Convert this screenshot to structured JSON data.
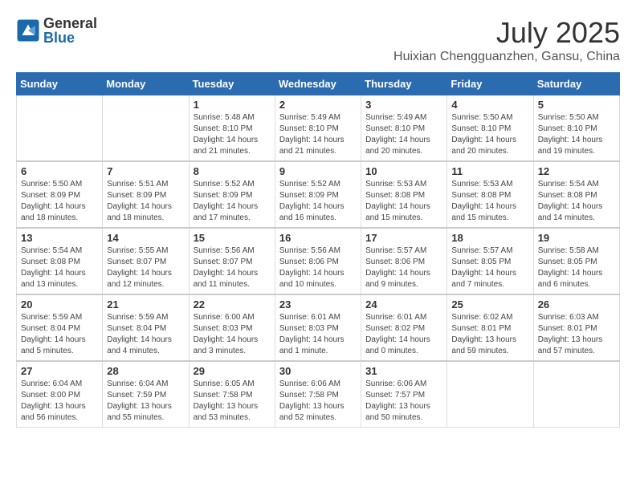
{
  "header": {
    "logo": {
      "general": "General",
      "blue": "Blue"
    },
    "title": "July 2025",
    "location": "Huixian Chengguanzhen, Gansu, China"
  },
  "calendar": {
    "days_of_week": [
      "Sunday",
      "Monday",
      "Tuesday",
      "Wednesday",
      "Thursday",
      "Friday",
      "Saturday"
    ],
    "weeks": [
      [
        {
          "day": "",
          "info": ""
        },
        {
          "day": "",
          "info": ""
        },
        {
          "day": "1",
          "info": "Sunrise: 5:48 AM\nSunset: 8:10 PM\nDaylight: 14 hours and 21 minutes."
        },
        {
          "day": "2",
          "info": "Sunrise: 5:49 AM\nSunset: 8:10 PM\nDaylight: 14 hours and 21 minutes."
        },
        {
          "day": "3",
          "info": "Sunrise: 5:49 AM\nSunset: 8:10 PM\nDaylight: 14 hours and 20 minutes."
        },
        {
          "day": "4",
          "info": "Sunrise: 5:50 AM\nSunset: 8:10 PM\nDaylight: 14 hours and 20 minutes."
        },
        {
          "day": "5",
          "info": "Sunrise: 5:50 AM\nSunset: 8:10 PM\nDaylight: 14 hours and 19 minutes."
        }
      ],
      [
        {
          "day": "6",
          "info": "Sunrise: 5:50 AM\nSunset: 8:09 PM\nDaylight: 14 hours and 18 minutes."
        },
        {
          "day": "7",
          "info": "Sunrise: 5:51 AM\nSunset: 8:09 PM\nDaylight: 14 hours and 18 minutes."
        },
        {
          "day": "8",
          "info": "Sunrise: 5:52 AM\nSunset: 8:09 PM\nDaylight: 14 hours and 17 minutes."
        },
        {
          "day": "9",
          "info": "Sunrise: 5:52 AM\nSunset: 8:09 PM\nDaylight: 14 hours and 16 minutes."
        },
        {
          "day": "10",
          "info": "Sunrise: 5:53 AM\nSunset: 8:08 PM\nDaylight: 14 hours and 15 minutes."
        },
        {
          "day": "11",
          "info": "Sunrise: 5:53 AM\nSunset: 8:08 PM\nDaylight: 14 hours and 15 minutes."
        },
        {
          "day": "12",
          "info": "Sunrise: 5:54 AM\nSunset: 8:08 PM\nDaylight: 14 hours and 14 minutes."
        }
      ],
      [
        {
          "day": "13",
          "info": "Sunrise: 5:54 AM\nSunset: 8:08 PM\nDaylight: 14 hours and 13 minutes."
        },
        {
          "day": "14",
          "info": "Sunrise: 5:55 AM\nSunset: 8:07 PM\nDaylight: 14 hours and 12 minutes."
        },
        {
          "day": "15",
          "info": "Sunrise: 5:56 AM\nSunset: 8:07 PM\nDaylight: 14 hours and 11 minutes."
        },
        {
          "day": "16",
          "info": "Sunrise: 5:56 AM\nSunset: 8:06 PM\nDaylight: 14 hours and 10 minutes."
        },
        {
          "day": "17",
          "info": "Sunrise: 5:57 AM\nSunset: 8:06 PM\nDaylight: 14 hours and 9 minutes."
        },
        {
          "day": "18",
          "info": "Sunrise: 5:57 AM\nSunset: 8:05 PM\nDaylight: 14 hours and 7 minutes."
        },
        {
          "day": "19",
          "info": "Sunrise: 5:58 AM\nSunset: 8:05 PM\nDaylight: 14 hours and 6 minutes."
        }
      ],
      [
        {
          "day": "20",
          "info": "Sunrise: 5:59 AM\nSunset: 8:04 PM\nDaylight: 14 hours and 5 minutes."
        },
        {
          "day": "21",
          "info": "Sunrise: 5:59 AM\nSunset: 8:04 PM\nDaylight: 14 hours and 4 minutes."
        },
        {
          "day": "22",
          "info": "Sunrise: 6:00 AM\nSunset: 8:03 PM\nDaylight: 14 hours and 3 minutes."
        },
        {
          "day": "23",
          "info": "Sunrise: 6:01 AM\nSunset: 8:03 PM\nDaylight: 14 hours and 1 minute."
        },
        {
          "day": "24",
          "info": "Sunrise: 6:01 AM\nSunset: 8:02 PM\nDaylight: 14 hours and 0 minutes."
        },
        {
          "day": "25",
          "info": "Sunrise: 6:02 AM\nSunset: 8:01 PM\nDaylight: 13 hours and 59 minutes."
        },
        {
          "day": "26",
          "info": "Sunrise: 6:03 AM\nSunset: 8:01 PM\nDaylight: 13 hours and 57 minutes."
        }
      ],
      [
        {
          "day": "27",
          "info": "Sunrise: 6:04 AM\nSunset: 8:00 PM\nDaylight: 13 hours and 56 minutes."
        },
        {
          "day": "28",
          "info": "Sunrise: 6:04 AM\nSunset: 7:59 PM\nDaylight: 13 hours and 55 minutes."
        },
        {
          "day": "29",
          "info": "Sunrise: 6:05 AM\nSunset: 7:58 PM\nDaylight: 13 hours and 53 minutes."
        },
        {
          "day": "30",
          "info": "Sunrise: 6:06 AM\nSunset: 7:58 PM\nDaylight: 13 hours and 52 minutes."
        },
        {
          "day": "31",
          "info": "Sunrise: 6:06 AM\nSunset: 7:57 PM\nDaylight: 13 hours and 50 minutes."
        },
        {
          "day": "",
          "info": ""
        },
        {
          "day": "",
          "info": ""
        }
      ]
    ]
  }
}
